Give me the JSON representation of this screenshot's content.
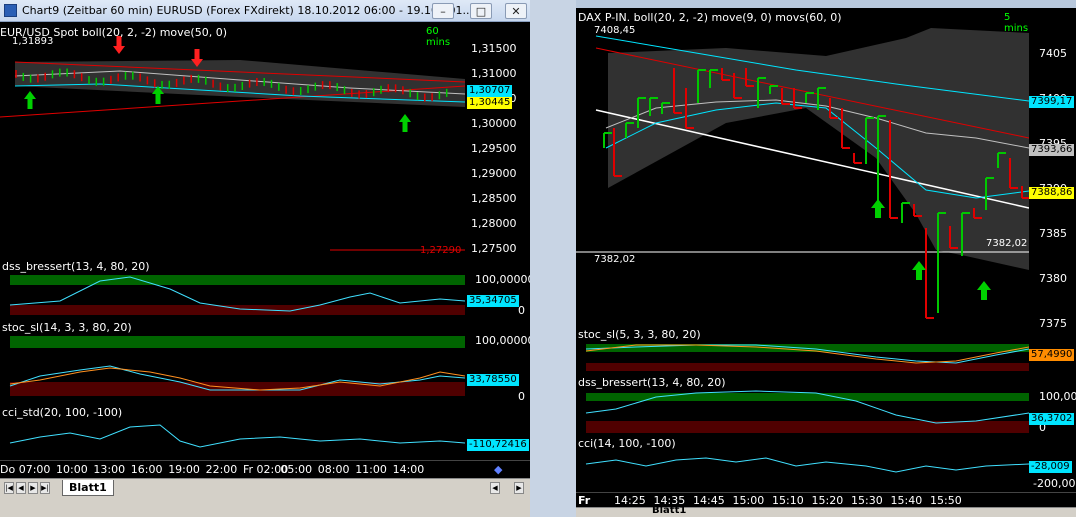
{
  "left_window": {
    "title": "Chart9 (Zeitbar 60 min)  EURUSD (Forex FXdirekt) 18.10.2012 06:00 - 19.10.201...",
    "main_panel": {
      "label": "EUR/USD Spot boll(20, 2, -2) move(50, 0)",
      "timeframe": "60 mins",
      "price_ticks": [
        "1,31500",
        "1,31000",
        "1,30500",
        "1,30000",
        "1,29500",
        "1,29000",
        "1,28500",
        "1,28000",
        "1,27500"
      ],
      "top_value": "1,31893",
      "bottom_value": "1,27290",
      "badge_upper": "1,30707",
      "badge_lower": "1,30445",
      "badge_upper_color": "#00e5ff",
      "badge_lower_color": "#ffff00"
    },
    "dss_panel": {
      "label": "dss_bressert(13, 4, 80, 20)",
      "ticks": [
        "100,00000",
        "0"
      ],
      "badge": "35,34705"
    },
    "stoc_panel": {
      "label": "stoc_sl(14, 3, 3, 80, 20)",
      "ticks": [
        "100,00000",
        "0"
      ],
      "badge": "33,78550"
    },
    "cci_panel": {
      "label": "cci_std(20, 100, -100)",
      "badge": "-110,72416"
    },
    "time_labels": [
      "Do 07:00",
      "10:00",
      "13:00",
      "16:00",
      "19:00",
      "22:00",
      "Fr 02:00",
      "05:00",
      "08:00",
      "11:00",
      "14:00"
    ],
    "sheet_tab": "Blatt1"
  },
  "right_window": {
    "main_panel": {
      "label": "DAX P-IN. boll(20, 2, -2) move(9, 0) movs(60, 0)",
      "timeframe": "5 mins",
      "top_value": "7408,45",
      "ref_value_left": "7382,02",
      "ref_value_right": "7382,02",
      "price_ticks": [
        "7405",
        "7400",
        "7395",
        "7390",
        "7385",
        "7380",
        "7375"
      ],
      "badge_1": "7399,17",
      "badge_2": "7393,66",
      "badge_3": "7388,86",
      "badge_1_color": "#00e5ff",
      "badge_2_color": "#c0c0c0",
      "badge_3_color": "#ffff00"
    },
    "stoc_panel": {
      "label": "stoc_sl(5, 3, 3, 80, 20)",
      "badge": "57,4990"
    },
    "dss_panel": {
      "label": "dss_bressert(13, 4, 80, 20)",
      "ticks": [
        "100,00",
        "0"
      ],
      "badge": "36,3702"
    },
    "cci_panel": {
      "label": "cci(14, 100, -100)",
      "badge_1": "-28,009",
      "badge_2": "-200,00"
    },
    "time_labels": [
      "Fr",
      "14:25",
      "14:35",
      "14:45",
      "15:00",
      "15:10",
      "15:20",
      "15:30",
      "15:40",
      "15:50"
    ],
    "sheet_tab": "Blatt1"
  },
  "colors": {
    "bull": "#00c800",
    "bear": "#e00000",
    "band_fill": "#5a5a5a",
    "overbought": "#006400",
    "oversold": "#500000",
    "indicator_line": "#40e0ff"
  }
}
